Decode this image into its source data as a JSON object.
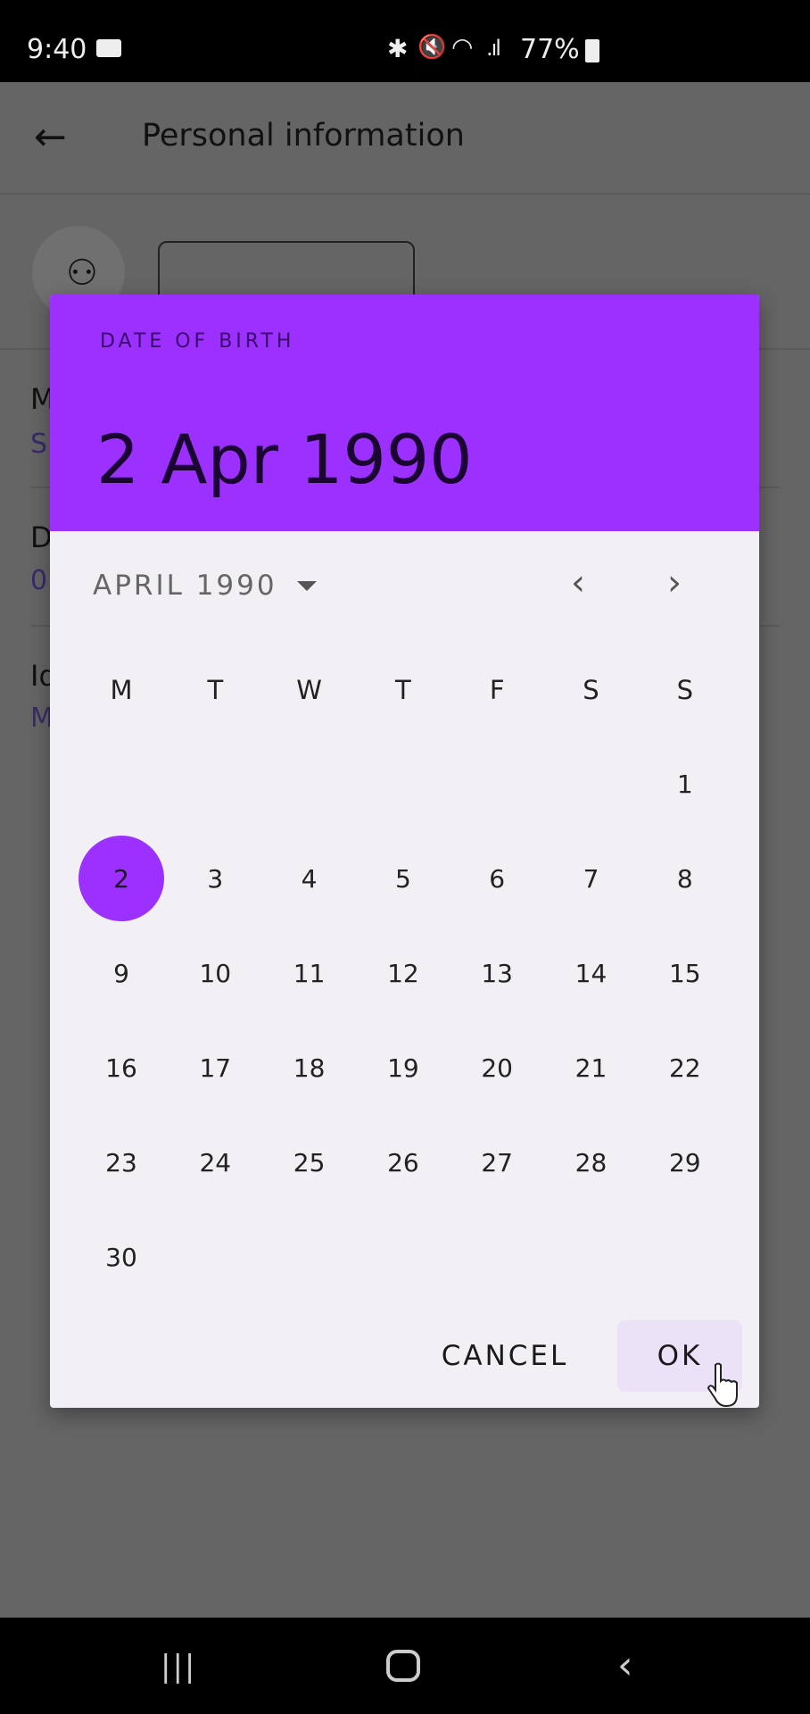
{
  "status_bar": {
    "time": "9:40",
    "battery": "77%",
    "icons": [
      "video-camera-icon",
      "bluetooth-icon",
      "mute-icon",
      "wifi-icon",
      "signal-icon",
      "battery-icon"
    ]
  },
  "app_bar": {
    "title": "Personal information",
    "back_icon": "arrow-left-icon"
  },
  "background_rows": [
    {
      "label": "M",
      "value": "S"
    },
    {
      "label": "D",
      "value": "0"
    },
    {
      "label": "Id",
      "value": "M"
    }
  ],
  "dialog": {
    "header_label": "DATE OF BIRTH",
    "selected_date": "2 Apr 1990",
    "month_year": "APRIL 1990",
    "weekdays": [
      "M",
      "T",
      "W",
      "T",
      "F",
      "S",
      "S"
    ],
    "weeks": [
      [
        null,
        null,
        null,
        null,
        null,
        null,
        1
      ],
      [
        2,
        3,
        4,
        5,
        6,
        7,
        8
      ],
      [
        9,
        10,
        11,
        12,
        13,
        14,
        15
      ],
      [
        16,
        17,
        18,
        19,
        20,
        21,
        22
      ],
      [
        23,
        24,
        25,
        26,
        27,
        28,
        29
      ],
      [
        30,
        null,
        null,
        null,
        null,
        null,
        null
      ]
    ],
    "selected_day": 2,
    "cancel_label": "CANCEL",
    "ok_label": "OK",
    "accent_color": "#9b30ff"
  }
}
